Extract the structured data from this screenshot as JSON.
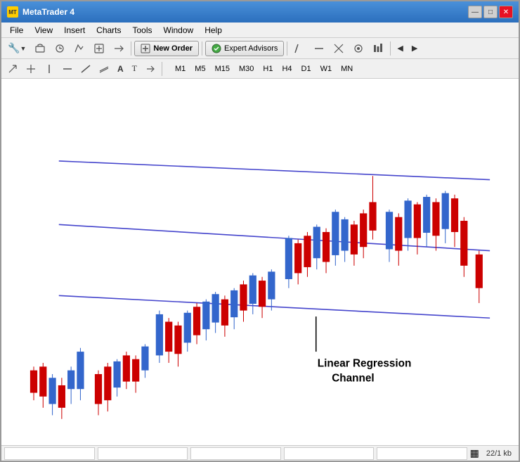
{
  "window": {
    "title": "MetaTrader 4",
    "icon": "MT4"
  },
  "title_bar": {
    "controls": {
      "minimize": "—",
      "maximize": "□",
      "close": "✕"
    }
  },
  "menu": {
    "items": [
      "File",
      "View",
      "Insert",
      "Charts",
      "Tools",
      "Window",
      "Help"
    ]
  },
  "toolbar1": {
    "new_order_label": "New Order",
    "expert_advisors_label": "Expert Advisors"
  },
  "toolbar2": {
    "timeframes": [
      "M1",
      "M5",
      "M15",
      "M30",
      "H1",
      "H4",
      "D1",
      "W1",
      "MN"
    ]
  },
  "chart": {
    "annotation": "Linear Regression\nChannel",
    "annotation_label_line1": "Linear Regression",
    "annotation_label_line2": "Channel"
  },
  "status_bar": {
    "info": "22/1 kb"
  }
}
